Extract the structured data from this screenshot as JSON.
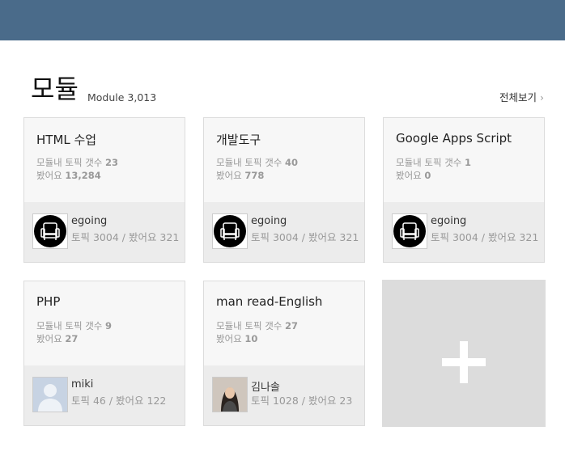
{
  "header": {
    "bar_color": "#4a6b8a"
  },
  "section": {
    "title": "모듈",
    "subtitle": "Module 3,013",
    "view_all": "전체보기",
    "view_all_icon": "chevron-right-icon"
  },
  "modules": [
    {
      "title": "HTML 수업",
      "topics_label": "모듈내 토픽 갯수",
      "topics": "23",
      "views_label": "봤어요",
      "views": "13,284",
      "user": {
        "name": "egoing",
        "stats": "토픽 3004 / 봤어요 321",
        "avatar": "armchair-avatar"
      }
    },
    {
      "title": "개발도구",
      "topics_label": "모듈내 토픽 갯수",
      "topics": "40",
      "views_label": "봤어요",
      "views": "778",
      "user": {
        "name": "egoing",
        "stats": "토픽 3004 / 봤어요 321",
        "avatar": "armchair-avatar"
      }
    },
    {
      "title": "Google Apps Script",
      "topics_label": "모듈내 토픽 갯수",
      "topics": "1",
      "views_label": "봤어요",
      "views": "0",
      "user": {
        "name": "egoing",
        "stats": "토픽 3004 / 봤어요 321",
        "avatar": "armchair-avatar"
      }
    },
    {
      "title": "PHP",
      "topics_label": "모듈내 토픽 갯수",
      "topics": "9",
      "views_label": "봤어요",
      "views": "27",
      "user": {
        "name": "miki",
        "stats": "토픽 46 / 봤어요 122",
        "avatar": "default-person-avatar"
      }
    },
    {
      "title": "man read-English",
      "topics_label": "모듈내 토픽 갯수",
      "topics": "27",
      "views_label": "봤어요",
      "views": "10",
      "user": {
        "name": "김나솔",
        "stats": "토픽 1028 / 봤어요 23",
        "avatar": "photo-avatar"
      }
    }
  ],
  "add_module": {
    "icon": "plus-icon"
  }
}
